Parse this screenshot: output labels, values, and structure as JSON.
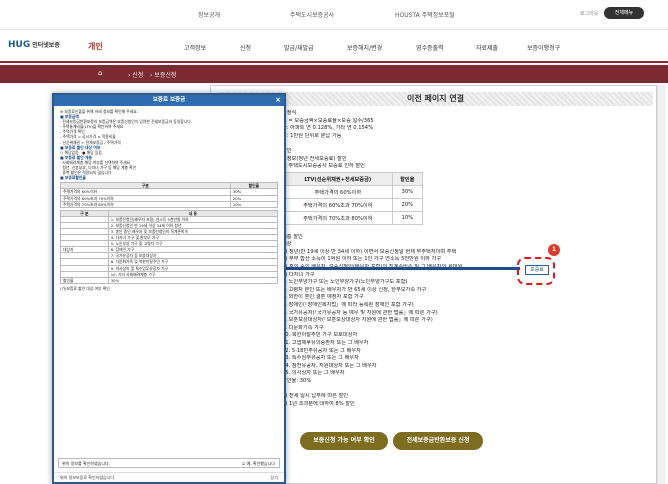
{
  "topbar": {
    "links": [
      "정보공개",
      "주택도시보증공사",
      "HOUSTA 주택정보포털"
    ],
    "login": "로그아웃",
    "all_menu": "전체메뉴"
  },
  "nav": {
    "logo_mark": "HUG",
    "logo_text": "인터넷보증",
    "current": "개인",
    "items": [
      "고객정보",
      "신청",
      "발급/재발급",
      "보증해지/변경",
      "영수증출력",
      "자료제출",
      "보증이행청구"
    ]
  },
  "breadcrumb": {
    "home": "⌂",
    "items": [
      "› 신청",
      "› 보증신청"
    ]
  },
  "page": {
    "title": "이전 페이지 연결",
    "confirm_button": "보증료"
  },
  "lines_top": [
    "산정식",
    "료 = 보증금액×보증료율×보증 일수/365",
    "율: 아파트 연 0.128%, 기타 연 0.154%",
    "할: 1만원 단위로 분납 가능",
    "",
    "할인",
    "요정보(청년 전세보증료) 할인",
    "및 주택도시보증공사 보증료 인하 할인"
  ],
  "ltv_table": {
    "header": [
      "LTV(선순위채권+전세보증금)",
      "할인율"
    ],
    "rows": [
      [
        "주택가격의 60%이하",
        "30%"
      ],
      [
        "주택가격의 60%초과 70%이하",
        "20%"
      ],
      [
        "주택가격의 70%초과 80%이하",
        "10%"
      ]
    ]
  },
  "lines_bottom": [
    "",
    "계층 할인",
    "대상",
    "1) 청년(만 19세 이상 만 34세 이하) 이면서 보증신청일 현재 무주택자이며 주택",
    "2) 부부 합산 소득이 1억원 이하 또는 1인 가구 연소득 5천만원 이하 가구",
    "3) 혼인 중인 배우자, 보증신청인(배우자 포함)의 직계존비속 및 그 배우자의 세대원",
    "4) 다자녀 가구",
    "3. 노인부양가구 또는 노인부양가구(노인부양가구도 포함)",
    "4. 고령자 본인 또는 배우자가 만 65세 이상 신청, 한부모가족 가구",
    "5. 외한이 혼인 결혼 예정자 포함 가구",
    "6. 장애인(「장애인복지법」에 따라 등록된 장애인 포함 가구)",
    "7. 국가유공자(「국가유공자 등 예우 및 지원에 관한 법률」에 따른 가구)",
    "8. 보훈보상대상자(「보훈보상대상자 지원에 관한 법률」에 따른 가구)",
    "9. 다문화가족 가구",
    "10. 북한이탈주민 가구 보호대상자",
    "11. 고엽제후유의증환자 또는 그 배우자",
    "12. 5·18민주유공자 또는 그 배우자",
    "13. 특수임무유공자 또는 그 배우자",
    "14. 참전유공자, 지원대상자 또는 그 배우자",
    "15. 의사상자 또는 그 배우자",
    "할인율: 30%",
    "",
    "2) 전세 일시 납부에 따른 할인",
    "2) 1년 초과분에 대하여 8% 할인"
  ],
  "bottom_buttons": [
    "보증신청 가능 여부 확인",
    "전세보증금반환보증 신청"
  ],
  "popup": {
    "title": "보증료 보증금",
    "close": "×",
    "intro": "※ 보증료산출을 위해 아래 정보를 확인해 주세요.",
    "s1": "■ 보증금액",
    "s1_lines": [
      "· 전세보증금반환보증의 보증금액은 보증신청인이 입력한 전세보증금과 동일합니다.",
      "· 주택통계비율(LTV)을 확인하여 주세요",
      "  - 주택가격 확인",
      "  - 주택가격 = 공시가격 × 적용비율",
      "  - 선순위채권 + 전세보증금 / 주택가격"
    ],
    "s2": "■ 보증료 할인 대상 여부",
    "s2_options": [
      "○ 해당없음",
      "● 해당 있음"
    ],
    "s3": "■ 보증료 할인 계층",
    "s3_lines": [
      "· 사회배려계층 해당 여부를 선택하여 주세요",
      "· 청년, 신혼부부, 다자녀 가구 등 해당 계층 확인",
      "· 중복 할인은 적용되지 않습니다"
    ],
    "ltv_label": "■ 보증료할인율",
    "ltv_head": [
      "구분",
      "할인율"
    ],
    "ltv_rows": [
      [
        "주택가격의 60%이하",
        "30%"
      ],
      [
        "주택가격의 60%초과 70%이하",
        "20%"
      ],
      [
        "주택가격의 70%초과 80%이하",
        "10%"
      ]
    ],
    "tbl2_head": [
      "구 분",
      "내 용"
    ],
    "tbl2_rows": [
      [
        "",
        "1. 보증신청인(배우자 포함) 연소득 5천만원 이하"
      ],
      [
        "",
        "2. 보증신청인 만 19세 이상 34세 이하 청년"
      ],
      [
        "",
        "3. 혼인 중인 배우자 및 보증신청인의 직계존비속"
      ],
      [
        "",
        "4. 다자녀 가구 및 한부모 가구"
      ],
      [
        "",
        "5. 노인부양 가구 및 고령자 가구"
      ],
      [
        "대상자",
        "6. 장애인 가구"
      ],
      [
        "",
        "7. 국가유공자 등 보훈대상자"
      ],
      [
        "",
        "8. 다문화가족 및 북한이탈주민 가구"
      ],
      [
        "",
        "9. 의사상자 및 특수임무유공자 가구"
      ],
      [
        "",
        "10. 기타 사회배려계층 가구"
      ],
      [
        "할인율",
        "30%"
      ]
    ],
    "note": "(가)보증료 할인 대상 여부 확인",
    "foot_text": "위의 정보를 확인하였습니다.",
    "foot_ok": "☑ 예, 확인했습니다",
    "bottom_left": "위의 정보보증료 확인하셨습니다.",
    "bottom_close": "닫기"
  }
}
